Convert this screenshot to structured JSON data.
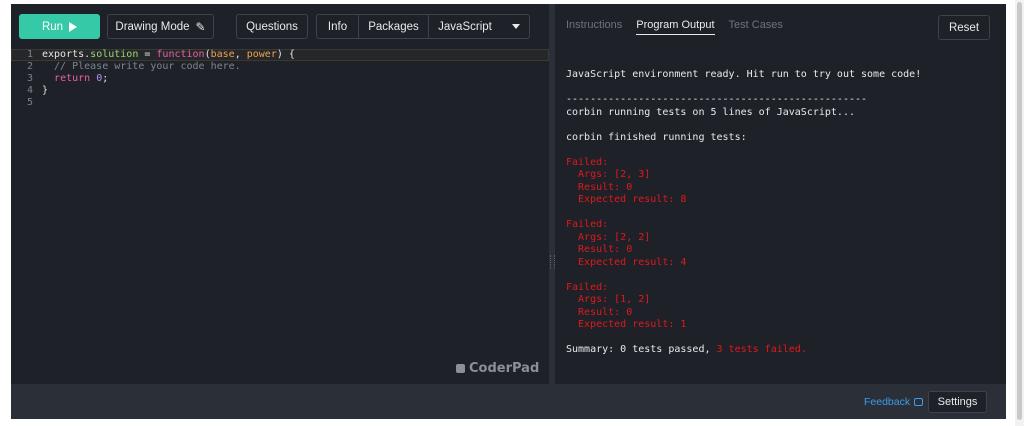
{
  "toolbar": {
    "run_label": "Run",
    "drawing_mode_label": "Drawing Mode",
    "questions_label": "Questions",
    "info_label": "Info",
    "packages_label": "Packages",
    "language_label": "JavaScript"
  },
  "editor": {
    "line_numbers": [
      "1",
      "2",
      "3",
      "4",
      "5"
    ],
    "lines": [
      [
        {
          "t": "exports.",
          "c": "plain"
        },
        {
          "t": "solution",
          "c": "prop"
        },
        {
          "t": " = ",
          "c": "plain"
        },
        {
          "t": "function",
          "c": "kw"
        },
        {
          "t": "(",
          "c": "plain"
        },
        {
          "t": "base",
          "c": "param"
        },
        {
          "t": ", ",
          "c": "plain"
        },
        {
          "t": "power",
          "c": "param"
        },
        {
          "t": ") {",
          "c": "plain"
        }
      ],
      [
        {
          "t": "  // Please write your code here.",
          "c": "com"
        }
      ],
      [
        {
          "t": "  ",
          "c": "plain"
        },
        {
          "t": "return",
          "c": "kw"
        },
        {
          "t": " ",
          "c": "plain"
        },
        {
          "t": "0",
          "c": "num"
        },
        {
          "t": ";",
          "c": "plain"
        }
      ],
      [
        {
          "t": "}",
          "c": "plain"
        }
      ],
      []
    ],
    "logo_text": "CoderPad"
  },
  "output_pane": {
    "tabs": [
      "Instructions",
      "Program Output",
      "Test Cases"
    ],
    "active_tab": "Program Output",
    "reset_label": "Reset",
    "ready_message": "JavaScript environment ready. Hit run to try out some code!",
    "separator": "--------------------------------------------------",
    "running_message": "corbin running tests on 5 lines of JavaScript...",
    "finished_message": "corbin finished running tests:",
    "failures": [
      {
        "header": "Failed:",
        "args": "  Args: [2, 3]",
        "result": "  Result: 0",
        "expected": "  Expected result: 8"
      },
      {
        "header": "Failed:",
        "args": "  Args: [2, 2]",
        "result": "  Result: 0",
        "expected": "  Expected result: 4"
      },
      {
        "header": "Failed:",
        "args": "  Args: [1, 2]",
        "result": "  Result: 0",
        "expected": "  Expected result: 1"
      }
    ],
    "summary_prefix": "Summary: 0 tests passed, ",
    "summary_failed": "3 tests failed."
  },
  "footer": {
    "feedback_label": "Feedback",
    "settings_label": "Settings"
  },
  "colors": {
    "run_button": "#35c9a8",
    "error_text": "#e0191b",
    "link": "#3d9be9"
  }
}
